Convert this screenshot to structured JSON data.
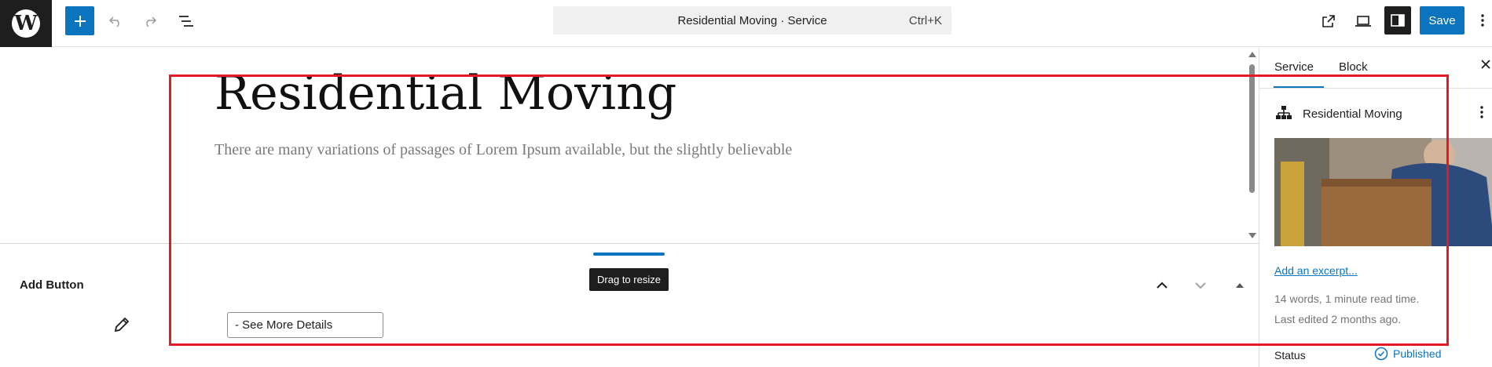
{
  "toolbar": {
    "command_title": "Residential Moving · Service",
    "command_shortcut": "Ctrl+K",
    "save_label": "Save",
    "icons": {
      "logo": "wordpress-logo",
      "add": "plus-icon",
      "undo": "undo-icon",
      "redo": "redo-icon",
      "list_view": "list-view-icon",
      "view_external": "external-link-icon",
      "device_preview": "laptop-icon",
      "settings": "sidebar-toggle-icon",
      "options": "more-vertical-icon"
    },
    "accent_color": "#0a74be"
  },
  "canvas": {
    "title": "Residential Moving",
    "excerpt": "There are many variations of passages of Lorem Ipsum available, but the slightly believable"
  },
  "resize": {
    "tooltip": "Drag to resize"
  },
  "meta_box": {
    "title": "Add Button",
    "button_text_value": "- See More Details"
  },
  "sidebar": {
    "tabs": [
      "Service",
      "Block"
    ],
    "active_tab": "Service",
    "post_name": "Residential Moving",
    "excerpt_link": "Add an excerpt...",
    "word_count": "14 words, 1 minute read time.",
    "last_edited": "Last edited 2 months ago.",
    "status_label": "Status",
    "status_value": "Published"
  },
  "highlight_color": "#e01b24"
}
